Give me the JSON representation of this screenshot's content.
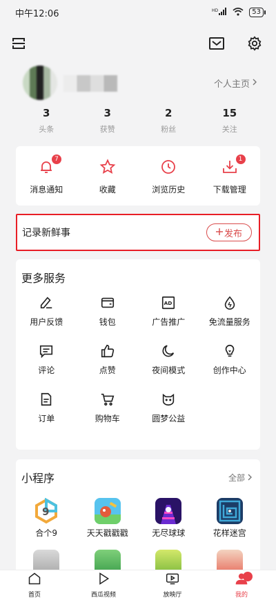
{
  "status": {
    "time": "中午12:06",
    "network": "HD 4G",
    "battery": "53"
  },
  "profile": {
    "homepage_link": "个人主页"
  },
  "stats": [
    {
      "num": "3",
      "label": "头条"
    },
    {
      "num": "3",
      "label": "获赞"
    },
    {
      "num": "2",
      "label": "粉丝"
    },
    {
      "num": "15",
      "label": "关注"
    }
  ],
  "quick": [
    {
      "label": "消息通知",
      "badge": "7",
      "icon": "bell-icon"
    },
    {
      "label": "收藏",
      "icon": "star-icon"
    },
    {
      "label": "浏览历史",
      "icon": "clock-icon"
    },
    {
      "label": "下载管理",
      "badge": "1",
      "icon": "download-icon"
    }
  ],
  "record": {
    "title": "记录新鲜事",
    "publish_label": "发布"
  },
  "services": {
    "title": "更多服务",
    "items": [
      {
        "label": "用户反馈",
        "icon": "feedback-icon"
      },
      {
        "label": "钱包",
        "icon": "wallet-icon"
      },
      {
        "label": "广告推广",
        "icon": "ad-icon"
      },
      {
        "label": "免流量服务",
        "icon": "drop-icon"
      },
      {
        "label": "评论",
        "icon": "comment-icon"
      },
      {
        "label": "点赞",
        "icon": "thumbs-up-icon"
      },
      {
        "label": "夜间模式",
        "icon": "moon-icon"
      },
      {
        "label": "创作中心",
        "icon": "bulb-icon"
      },
      {
        "label": "订单",
        "icon": "order-icon"
      },
      {
        "label": "购物车",
        "icon": "cart-icon"
      },
      {
        "label": "圆梦公益",
        "icon": "charity-icon"
      }
    ]
  },
  "mini_programs": {
    "title": "小程序",
    "all_label": "全部",
    "apps": [
      {
        "label": "合个9"
      },
      {
        "label": "天天戳戳戳"
      },
      {
        "label": "无尽球球"
      },
      {
        "label": "花样迷宫"
      },
      {
        "label": ""
      },
      {
        "label": ""
      },
      {
        "label": ""
      },
      {
        "label": ""
      }
    ]
  },
  "tabbar": [
    {
      "label": "首页",
      "icon": "home-icon"
    },
    {
      "label": "西瓜视频",
      "icon": "play-icon"
    },
    {
      "label": "放映厅",
      "icon": "tv-icon"
    },
    {
      "label": "我的",
      "icon": "user-icon",
      "active": true
    }
  ],
  "colors": {
    "accent": "#e8404a",
    "record_border": "#e81d25",
    "background": "#f3f3f4"
  }
}
